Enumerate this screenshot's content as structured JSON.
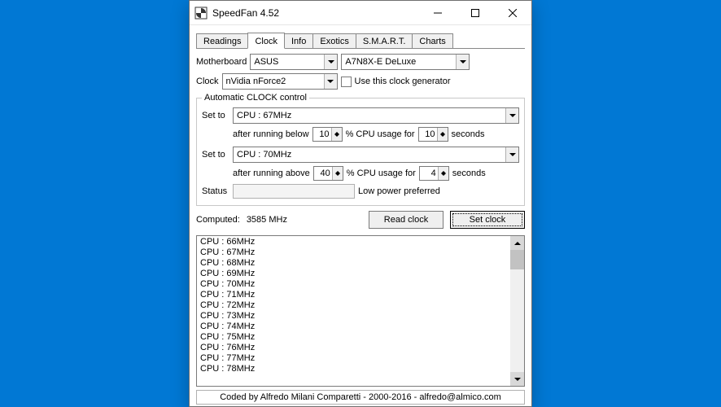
{
  "window": {
    "title": "SpeedFan 4.52"
  },
  "tabs": [
    "Readings",
    "Clock",
    "Info",
    "Exotics",
    "S.M.A.R.T.",
    "Charts"
  ],
  "active_tab_index": 1,
  "motherboard": {
    "label": "Motherboard",
    "vendor": "ASUS",
    "model": "A7N8X-E DeLuxe"
  },
  "clock": {
    "label": "Clock",
    "chip": "nVidia nForce2",
    "use_generator_label": "Use this clock generator"
  },
  "auto_control": {
    "legend": "Automatic CLOCK control",
    "set_to_label": "Set to",
    "low_freq": "CPU : 67MHz",
    "low_below_text": "after running below",
    "low_below_pct": "10",
    "pct_usage_text": "% CPU usage for",
    "low_below_secs": "10",
    "seconds_text": "seconds",
    "high_freq": "CPU : 70MHz",
    "high_above_text": "after running above",
    "high_above_pct": "40",
    "high_above_secs": "4",
    "status_label": "Status",
    "mode_text": "Low power preferred"
  },
  "computed": {
    "label": "Computed:",
    "value": "3585 MHz"
  },
  "buttons": {
    "read": "Read clock",
    "set": "Set clock"
  },
  "freq_list": [
    "CPU : 66MHz",
    "CPU : 67MHz",
    "CPU : 68MHz",
    "CPU : 69MHz",
    "CPU : 70MHz",
    "CPU : 71MHz",
    "CPU : 72MHz",
    "CPU : 73MHz",
    "CPU : 74MHz",
    "CPU : 75MHz",
    "CPU : 76MHz",
    "CPU : 77MHz",
    "CPU : 78MHz"
  ],
  "footer": "Coded by Alfredo Milani Comparetti - 2000-2016 - alfredo@almico.com"
}
